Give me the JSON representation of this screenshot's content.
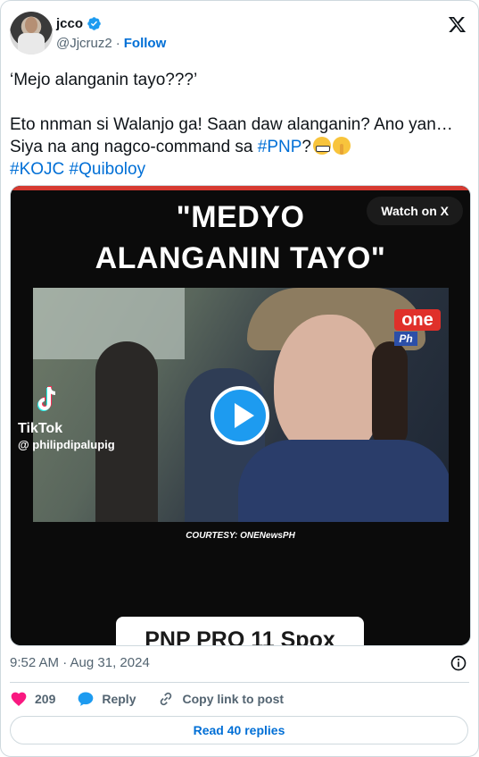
{
  "author": {
    "display_name": "jcco",
    "handle": "@Jjcruz2",
    "separator": "·",
    "follow_label": "Follow",
    "verified_icon": "verified-badge-icon"
  },
  "post": {
    "line1": "‘Mejo alanganin tayo???’",
    "line2_text": "Eto nnman si Walanjo ga! Saan daw alanganin? Ano yan… Siya na ang nagco-command sa ",
    "hashtag_pnp": "#PNP",
    "question_mark": "?",
    "hashtag_kojc": "#KOJC",
    "hashtag_quiboloy": "#Quiboloy"
  },
  "media": {
    "headline_line1": "\"MEDYO",
    "headline_line2": "ALANGANIN TAYO\"",
    "watch_label": "Watch on X",
    "tiktok_label": "TikTok",
    "tiktok_user": "@ philipdipalupig",
    "courtesy": "COURTESY: ONENewsPH",
    "banner_text": "PNP PRO 11 Spox",
    "logo_one": "one",
    "logo_ph": "Ph"
  },
  "meta": {
    "timestamp": "9:52 AM · Aug 31, 2024"
  },
  "actions": {
    "like_count": "209",
    "reply_label": "Reply",
    "copy_label": "Copy link to post"
  },
  "footer": {
    "read_replies_label": "Read 40 replies"
  },
  "colors": {
    "link_blue": "#006fd6",
    "like_red": "#f91880",
    "play_blue": "#1d9bf0",
    "media_red_bar": "#d63a31"
  }
}
